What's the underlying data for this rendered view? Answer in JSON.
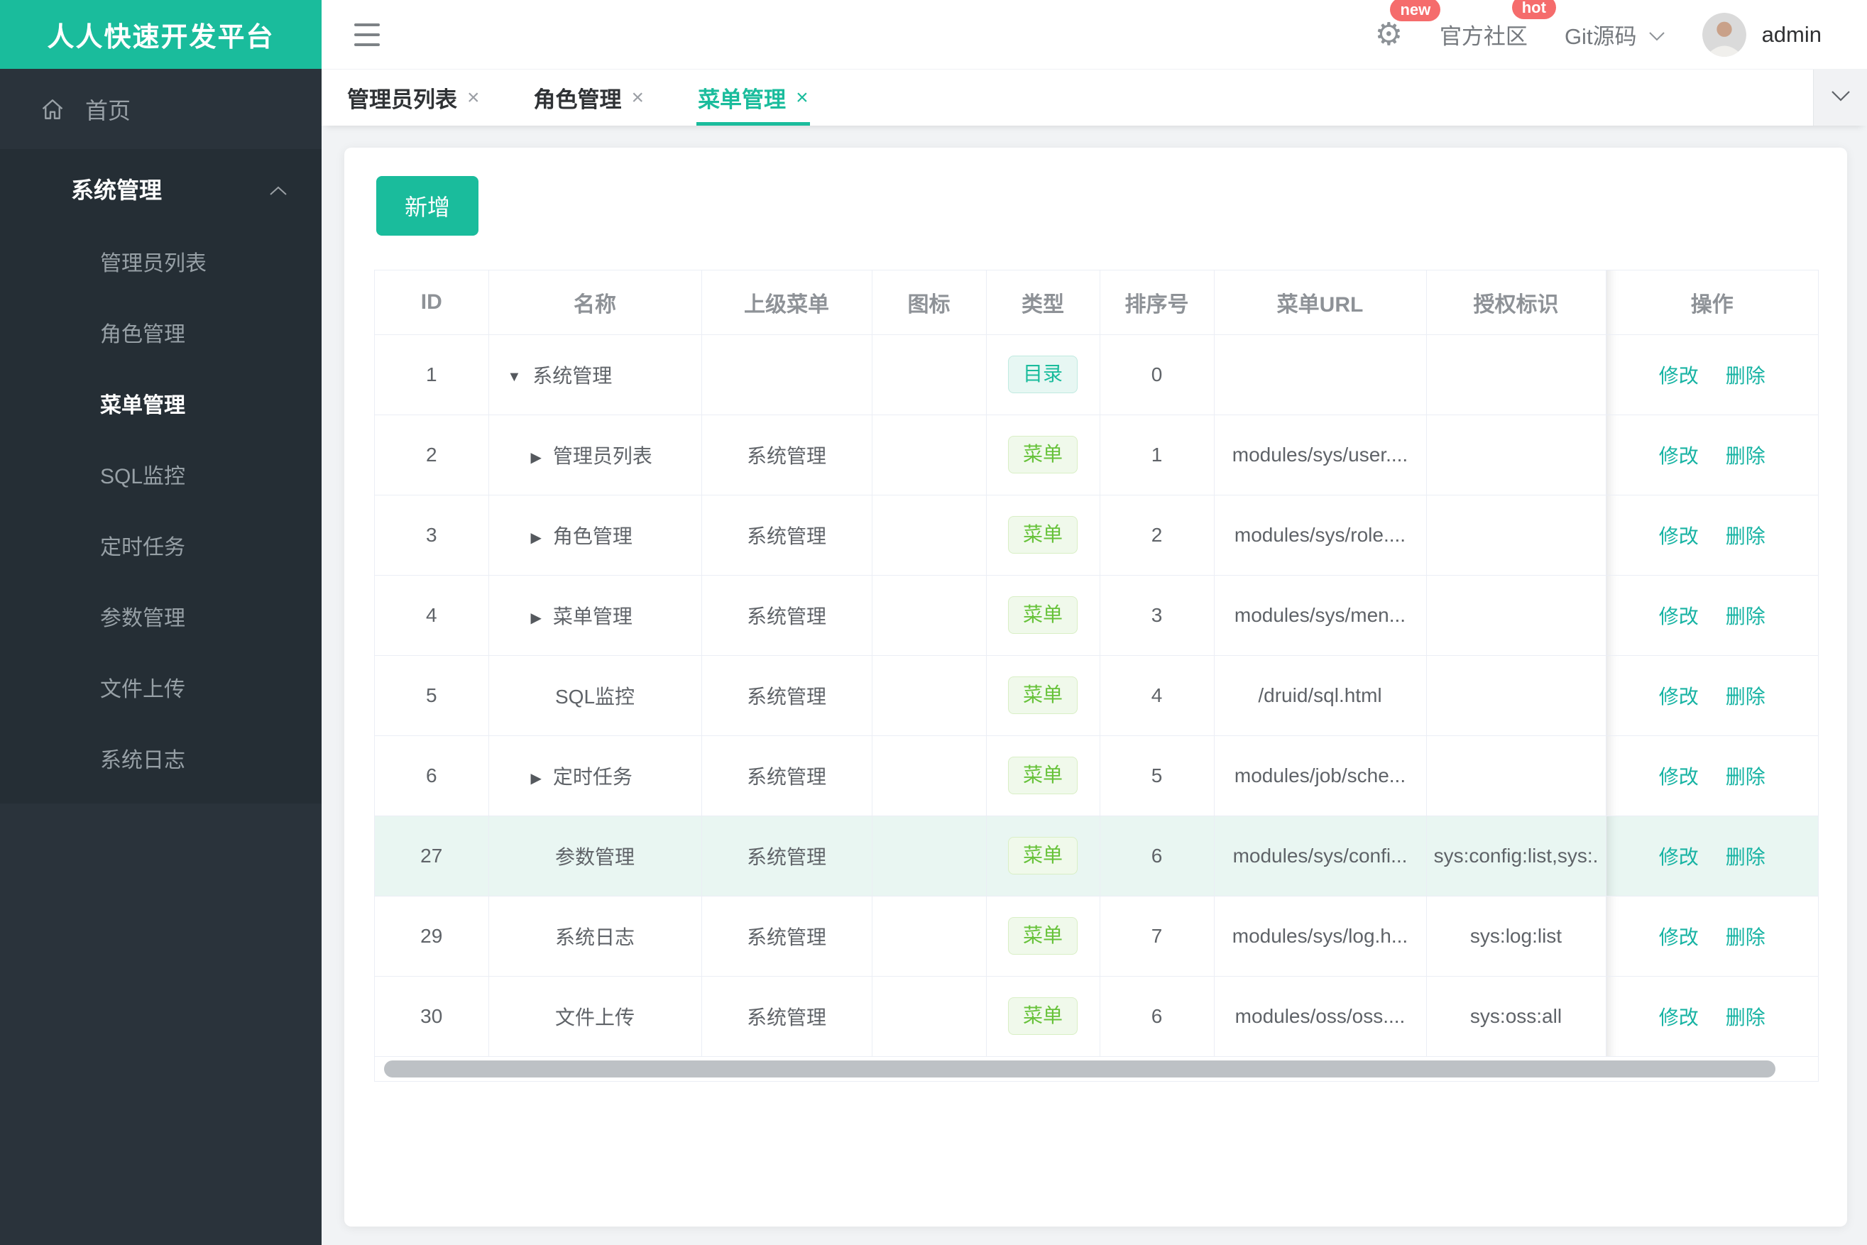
{
  "app": {
    "logo_title": "人人快速开发平台"
  },
  "colors": {
    "accent": "#1abc9c",
    "badge_red": "#f56c6c",
    "tag_menu_green": "#67c23a",
    "sidebar_bg": "#2a333b",
    "row_highlight": "#e9f6f2"
  },
  "icons": {
    "menu_toggle": "hamburger-icon",
    "settings": "gear-icon",
    "git_dropdown": "chevron-down-icon",
    "tabs_more": "chevron-down-icon",
    "group_collapse": "chevron-up-icon",
    "home": "home-icon",
    "tab_close": "close-icon",
    "row_expanded": "caret-down-icon",
    "row_collapsed": "caret-right-icon",
    "user": "avatar"
  },
  "sidebar": {
    "home_label": "首页",
    "group": {
      "title": "系统管理",
      "items": [
        {
          "label": "管理员列表",
          "active": false
        },
        {
          "label": "角色管理",
          "active": false
        },
        {
          "label": "菜单管理",
          "active": true
        },
        {
          "label": "SQL监控",
          "active": false
        },
        {
          "label": "定时任务",
          "active": false
        },
        {
          "label": "参数管理",
          "active": false
        },
        {
          "label": "文件上传",
          "active": false
        },
        {
          "label": "系统日志",
          "active": false
        }
      ]
    }
  },
  "header": {
    "settings_badge": "new",
    "community_label": "官方社区",
    "community_badge": "hot",
    "git_label": "Git源码",
    "username": "admin"
  },
  "tabs": [
    {
      "label": "管理员列表",
      "active": false
    },
    {
      "label": "角色管理",
      "active": false
    },
    {
      "label": "菜单管理",
      "active": true
    }
  ],
  "toolbar": {
    "add_label": "新增"
  },
  "table": {
    "columns": [
      "ID",
      "名称",
      "上级菜单",
      "图标",
      "类型",
      "排序号",
      "菜单URL",
      "授权标识",
      "操作"
    ],
    "ops": {
      "edit": "修改",
      "delete": "删除"
    },
    "rows": [
      {
        "id": "1",
        "arrow": "down",
        "indent": 0,
        "name": "系统管理",
        "parent": "",
        "icon": "",
        "type": {
          "label": "目录",
          "kind": "dir"
        },
        "order": "0",
        "url": "",
        "perm": "",
        "highlighted": false
      },
      {
        "id": "2",
        "arrow": "right",
        "indent": 1,
        "name": "管理员列表",
        "parent": "系统管理",
        "icon": "",
        "type": {
          "label": "菜单",
          "kind": "menu"
        },
        "order": "1",
        "url": "modules/sys/user....",
        "perm": "",
        "highlighted": false
      },
      {
        "id": "3",
        "arrow": "right",
        "indent": 1,
        "name": "角色管理",
        "parent": "系统管理",
        "icon": "",
        "type": {
          "label": "菜单",
          "kind": "menu"
        },
        "order": "2",
        "url": "modules/sys/role....",
        "perm": "",
        "highlighted": false
      },
      {
        "id": "4",
        "arrow": "right",
        "indent": 1,
        "name": "菜单管理",
        "parent": "系统管理",
        "icon": "",
        "type": {
          "label": "菜单",
          "kind": "menu"
        },
        "order": "3",
        "url": "modules/sys/men...",
        "perm": "",
        "highlighted": false
      },
      {
        "id": "5",
        "arrow": null,
        "indent": 1,
        "name": "SQL监控",
        "parent": "系统管理",
        "icon": "",
        "type": {
          "label": "菜单",
          "kind": "menu"
        },
        "order": "4",
        "url": "/druid/sql.html",
        "perm": "",
        "highlighted": false
      },
      {
        "id": "6",
        "arrow": "right",
        "indent": 1,
        "name": "定时任务",
        "parent": "系统管理",
        "icon": "",
        "type": {
          "label": "菜单",
          "kind": "menu"
        },
        "order": "5",
        "url": "modules/job/sche...",
        "perm": "",
        "highlighted": false
      },
      {
        "id": "27",
        "arrow": null,
        "indent": 1,
        "name": "参数管理",
        "parent": "系统管理",
        "icon": "",
        "type": {
          "label": "菜单",
          "kind": "menu"
        },
        "order": "6",
        "url": "modules/sys/confi...",
        "perm": "sys:config:list,sys:.",
        "highlighted": true
      },
      {
        "id": "29",
        "arrow": null,
        "indent": 1,
        "name": "系统日志",
        "parent": "系统管理",
        "icon": "",
        "type": {
          "label": "菜单",
          "kind": "menu"
        },
        "order": "7",
        "url": "modules/sys/log.h...",
        "perm": "sys:log:list",
        "highlighted": false
      },
      {
        "id": "30",
        "arrow": null,
        "indent": 1,
        "name": "文件上传",
        "parent": "系统管理",
        "icon": "",
        "type": {
          "label": "菜单",
          "kind": "menu"
        },
        "order": "6",
        "url": "modules/oss/oss....",
        "perm": "sys:oss:all",
        "highlighted": false
      }
    ]
  }
}
